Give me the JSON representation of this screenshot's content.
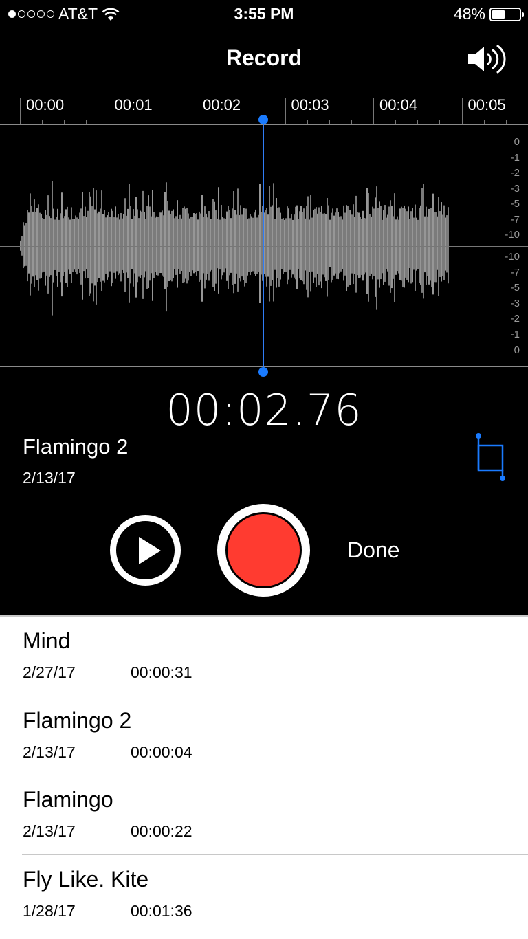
{
  "status_bar": {
    "signal_dots": 5,
    "signal_filled": 1,
    "carrier": "AT&T",
    "time": "3:55 PM",
    "battery_percent_label": "48%",
    "battery_level": 0.48,
    "icons": [
      "signal-dots-icon",
      "wifi-icon",
      "battery-icon"
    ]
  },
  "header": {
    "title": "Record",
    "speaker_icon": "speaker-volume-icon"
  },
  "timeline": {
    "labels": [
      "00:00",
      "00:01",
      "00:02",
      "00:03",
      "00:04",
      "00:05"
    ]
  },
  "level_scale": {
    "top": [
      "0",
      "-1",
      "-2",
      "-3",
      "-5",
      "-7",
      "-10"
    ],
    "bottom": [
      "-10",
      "-7",
      "-5",
      "-3",
      "-2",
      "-1",
      "0"
    ]
  },
  "playhead": {
    "position_seconds": 2.76,
    "color": "#1a7bff"
  },
  "recording": {
    "elapsed": "00:02.76",
    "name": "Flamingo 2",
    "date": "2/13/17",
    "trim_icon": "trim-icon"
  },
  "controls": {
    "play_icon": "play-icon",
    "record_color": "#ff3b30",
    "done_label": "Done"
  },
  "recordings_list": [
    {
      "name": "Mind",
      "date": "2/27/17",
      "duration": "00:00:31"
    },
    {
      "name": "Flamingo 2",
      "date": "2/13/17",
      "duration": "00:00:04"
    },
    {
      "name": "Flamingo",
      "date": "2/13/17",
      "duration": "00:00:22"
    },
    {
      "name": "Fly Like. Kite",
      "date": "1/28/17",
      "duration": "00:01:36"
    }
  ]
}
